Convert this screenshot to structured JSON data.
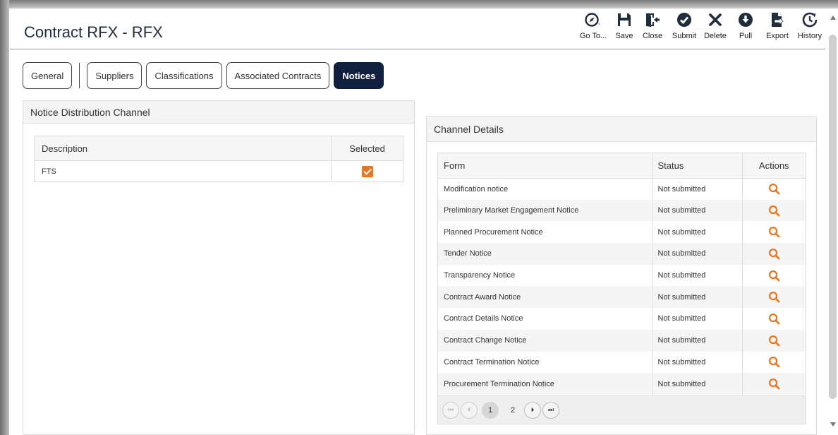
{
  "page": {
    "title": "Contract RFX - RFX"
  },
  "toolbar": [
    {
      "label": "Go To...",
      "icon": "compass-icon"
    },
    {
      "label": "Save",
      "icon": "save-icon"
    },
    {
      "label": "Close",
      "icon": "close-door-icon"
    },
    {
      "label": "Submit",
      "icon": "check-circle-icon"
    },
    {
      "label": "Delete",
      "icon": "x-icon"
    },
    {
      "label": "Pull",
      "icon": "download-circle-icon"
    },
    {
      "label": "Export",
      "icon": "export-doc-icon"
    },
    {
      "label": "History",
      "icon": "history-icon"
    }
  ],
  "tabs": [
    {
      "label": "General",
      "active": false
    },
    {
      "label": "Suppliers",
      "active": false
    },
    {
      "label": "Classifications",
      "active": false
    },
    {
      "label": "Associated Contracts",
      "active": false
    },
    {
      "label": "Notices",
      "active": true
    }
  ],
  "distribution": {
    "heading": "Notice Distribution Channel",
    "columns": [
      "Description",
      "Selected"
    ],
    "rows": [
      {
        "description": "FTS",
        "selected": true
      }
    ]
  },
  "channel": {
    "heading": "Channel Details",
    "columns": [
      "Form",
      "Status",
      "Actions"
    ],
    "rows": [
      {
        "form": "Modification notice",
        "status": "Not submitted"
      },
      {
        "form": "Preliminary Market Engagement Notice",
        "status": "Not submitted"
      },
      {
        "form": "Planned Procurement Notice",
        "status": "Not submitted"
      },
      {
        "form": "Tender Notice",
        "status": "Not submitted"
      },
      {
        "form": "Transparency Notice",
        "status": "Not submitted"
      },
      {
        "form": "Contract Award Notice",
        "status": "Not submitted"
      },
      {
        "form": "Contract Details Notice",
        "status": "Not submitted"
      },
      {
        "form": "Contract Change Notice",
        "status": "Not submitted"
      },
      {
        "form": "Contract Termination Notice",
        "status": "Not submitted"
      },
      {
        "form": "Procurement Termination Notice",
        "status": "Not submitted"
      }
    ],
    "pager": {
      "pages": [
        "1",
        "2"
      ],
      "current": "1"
    }
  },
  "colors": {
    "accent": "#e8761c",
    "active_tab": "#0f1f3d",
    "icon": "#1f2d3d"
  }
}
